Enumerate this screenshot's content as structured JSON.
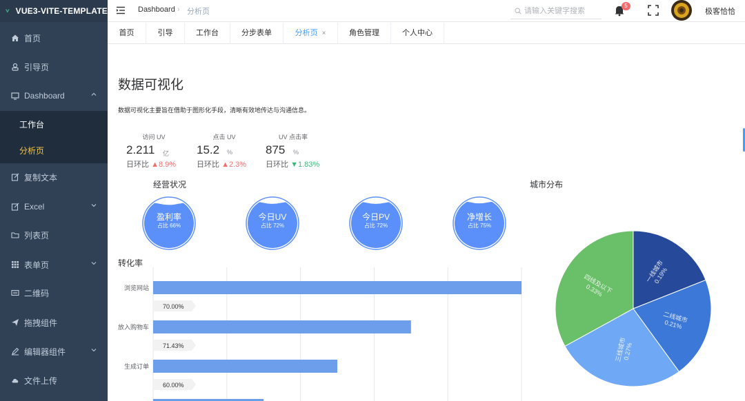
{
  "app": {
    "title": "VUE3-VITE-TEMPLATE"
  },
  "sidebar": {
    "items": [
      {
        "label": "首页",
        "icon": "home-icon"
      },
      {
        "label": "引导页",
        "icon": "guide-icon"
      },
      {
        "label": "Dashboard",
        "icon": "dashboard-icon",
        "expanded": true,
        "children": [
          {
            "label": "工作台"
          },
          {
            "label": "分析页",
            "active": true
          }
        ]
      },
      {
        "label": "复制文本",
        "icon": "copy-icon"
      },
      {
        "label": "Excel",
        "icon": "excel-icon",
        "has_children": true
      },
      {
        "label": "列表页",
        "icon": "folder-icon"
      },
      {
        "label": "表单页",
        "icon": "grid-icon",
        "has_children": true
      },
      {
        "label": "二维码",
        "icon": "qrcode-icon"
      },
      {
        "label": "拖拽组件",
        "icon": "drag-icon"
      },
      {
        "label": "编辑器组件",
        "icon": "editor-icon",
        "has_children": true
      },
      {
        "label": "文件上传",
        "icon": "upload-icon"
      }
    ]
  },
  "header": {
    "breadcrumb": [
      "Dashboard",
      "分析页"
    ],
    "search_placeholder": "请输入关键字搜索",
    "notification_count": "5",
    "username": "极客恰恰"
  },
  "tags": [
    {
      "label": "首页"
    },
    {
      "label": "引导"
    },
    {
      "label": "工作台"
    },
    {
      "label": "分步表单"
    },
    {
      "label": "分析页",
      "active": true,
      "closable": true
    },
    {
      "label": "角色管理"
    },
    {
      "label": "个人中心"
    }
  ],
  "page": {
    "title": "数据可视化",
    "description": "数据可视化主要旨在借助于图形化手段，清晰有效地传达与沟通信息。"
  },
  "stats": [
    {
      "label": "访问 UV",
      "value": "2.211",
      "unit": "亿",
      "ring_label": "日环比",
      "trend": "up",
      "change": "8.9%"
    },
    {
      "label": "点击 UV",
      "value": "15.2",
      "unit": "%",
      "ring_label": "日环比",
      "trend": "up",
      "change": "2.3%"
    },
    {
      "label": "UV 点击率",
      "value": "875",
      "unit": "%",
      "ring_label": "日环比",
      "trend": "down",
      "change": "1.83%"
    }
  ],
  "sections": {
    "business": "经营状况",
    "conversion": "转化率",
    "city": "城市分布"
  },
  "gauges": [
    {
      "title": "盈利率",
      "sub": "占比 66%",
      "fill": 0.86
    },
    {
      "title": "今日UV",
      "sub": "占比 72%",
      "fill": 0.88
    },
    {
      "title": "今日PV",
      "sub": "占比 72%",
      "fill": 0.88
    },
    {
      "title": "净增长",
      "sub": "占比 75%",
      "fill": 0.89
    }
  ],
  "colors": {
    "accent": "#409eff",
    "sidebar_bg": "#304156",
    "gauge_blue": "#5b8ff9",
    "bar_blue": "#6d9eeb",
    "up": "#f56c6c",
    "down": "#3ab87c"
  },
  "chart_data": [
    {
      "type": "bar",
      "orientation": "horizontal",
      "title": "转化率",
      "categories": [
        "浏览网站",
        "放入购物车",
        "生成订单"
      ],
      "values": [
        100,
        70,
        50
      ],
      "data_labels": [
        "70.00%",
        "71.43%",
        "60.00%"
      ],
      "xlim": [
        0,
        100
      ],
      "grid": true
    },
    {
      "type": "pie",
      "title": "城市分布",
      "categories": [
        "一线城市",
        "二线城市",
        "三线城市",
        "四线及以下"
      ],
      "labels": [
        [
          "一线城市",
          "0.19%"
        ],
        [
          "二线城市",
          "0.21%"
        ],
        [
          "三线城市",
          "0.27%"
        ],
        [
          "四线及以下",
          "0.33%"
        ]
      ],
      "values": [
        19,
        21,
        27,
        33
      ],
      "colors": [
        "#26499a",
        "#3c78d8",
        "#6fa8f5",
        "#6abf69"
      ]
    }
  ]
}
